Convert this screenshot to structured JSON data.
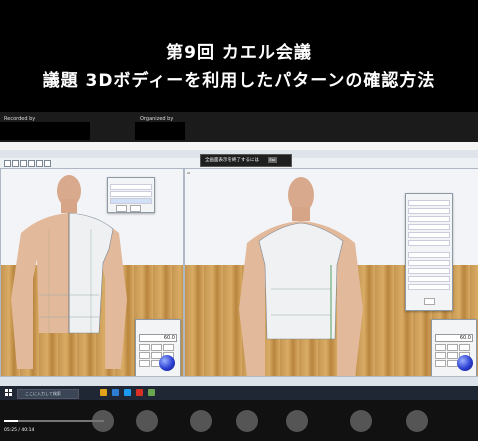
{
  "slide": {
    "title_line1": "第9回  カエル会議",
    "title_line2": "議題  3Dボディーを利用したパターンの確認方法"
  },
  "zoom": {
    "recorded_by": "Recorded by",
    "organized_by": "Organized by"
  },
  "app": {
    "banner_text": "全画面表示を終了するには",
    "banner_key": "Esc",
    "left_numpad_value": "60.0",
    "right_numpad_value": "60.0"
  },
  "taskbar": {
    "search_placeholder": "ここに入力して検索"
  },
  "player": {
    "time_label": "05:25 / 40:14",
    "progress_fraction": 0.14
  },
  "colors": {
    "ball": "#2b3fd1",
    "floor": "#c59652"
  }
}
